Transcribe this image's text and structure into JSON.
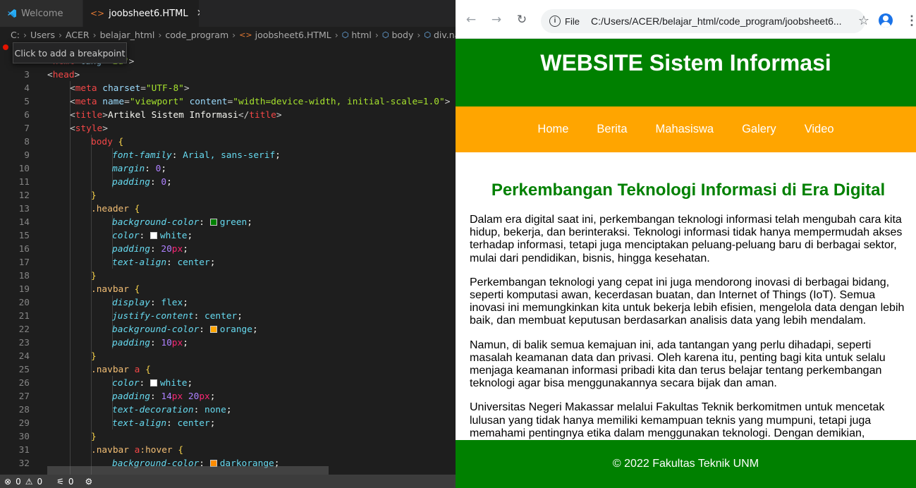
{
  "vscode": {
    "tabs": [
      {
        "label": "Welcome",
        "active": false
      },
      {
        "label": "joobsheet6.HTML",
        "active": true
      }
    ],
    "breadcrumb": [
      "C:",
      "Users",
      "ACER",
      "belajar_html",
      "code_program",
      "joobsheet6.HTML",
      "html",
      "body",
      "div.nav"
    ],
    "tooltip": "Click to add a breakpoint",
    "status": {
      "errors": "0",
      "warnings": "0",
      "ports": "0"
    },
    "lines": [
      {
        "n": "3",
        "text": "<head>"
      },
      {
        "n": "4",
        "text": "<meta charset=\"UTF-8\">"
      },
      {
        "n": "5",
        "text": "<meta name=\"viewport\" content=\"width=device-width, initial-scale=1.0\">"
      },
      {
        "n": "6",
        "text": "<title>Artikel Sistem Informasi</title>"
      },
      {
        "n": "7",
        "text": "<style>"
      },
      {
        "n": "8",
        "text": "body {"
      },
      {
        "n": "9",
        "text": "font-family: Arial, sans-serif;"
      },
      {
        "n": "10",
        "text": "margin: 0;"
      },
      {
        "n": "11",
        "text": "padding: 0;"
      },
      {
        "n": "12",
        "text": "}"
      },
      {
        "n": "13",
        "text": ".header {"
      },
      {
        "n": "14",
        "text": "background-color: green;"
      },
      {
        "n": "15",
        "text": "color: white;"
      },
      {
        "n": "16",
        "text": "padding: 20px;"
      },
      {
        "n": "17",
        "text": "text-align: center;"
      },
      {
        "n": "18",
        "text": "}"
      },
      {
        "n": "19",
        "text": ".navbar {"
      },
      {
        "n": "20",
        "text": "display: flex;"
      },
      {
        "n": "21",
        "text": "justify-content: center;"
      },
      {
        "n": "22",
        "text": "background-color: orange;"
      },
      {
        "n": "23",
        "text": "padding: 10px;"
      },
      {
        "n": "24",
        "text": "}"
      },
      {
        "n": "25",
        "text": ".navbar a {"
      },
      {
        "n": "26",
        "text": "color: white;"
      },
      {
        "n": "27",
        "text": "padding: 14px 20px;"
      },
      {
        "n": "28",
        "text": "text-decoration: none;"
      },
      {
        "n": "29",
        "text": "text-align: center;"
      },
      {
        "n": "30",
        "text": "}"
      },
      {
        "n": "31",
        "text": ".navbar a:hover {"
      },
      {
        "n": "32",
        "text": "background-color: darkorange;"
      }
    ]
  },
  "browser": {
    "omnibox_scheme": "File",
    "omnibox_url": "C:/Users/ACER/belajar_html/code_program/joobsheet6....",
    "page": {
      "header_title": "WEBSITE Sistem Informasi",
      "nav": [
        "Home",
        "Berita",
        "Mahasiswa",
        "Galery",
        "Video"
      ],
      "article_title": "Perkembangan Teknologi Informasi di Era Digital",
      "paragraphs": [
        "Dalam era digital saat ini, perkembangan teknologi informasi telah mengubah cara kita hidup, bekerja, dan berinteraksi. Teknologi informasi tidak hanya mempermudah akses terhadap informasi, tetapi juga menciptakan peluang-peluang baru di berbagai sektor, mulai dari pendidikan, bisnis, hingga kesehatan.",
        "Perkembangan teknologi yang cepat ini juga mendorong inovasi di berbagai bidang, seperti komputasi awan, kecerdasan buatan, dan Internet of Things (IoT). Semua inovasi ini memungkinkan kita untuk bekerja lebih efisien, mengelola data dengan lebih baik, dan membuat keputusan berdasarkan analisis data yang lebih mendalam.",
        "Namun, di balik semua kemajuan ini, ada tantangan yang perlu dihadapi, seperti masalah keamanan data dan privasi. Oleh karena itu, penting bagi kita untuk selalu menjaga keamanan informasi pribadi kita dan terus belajar tentang perkembangan teknologi agar bisa menggunakannya secara bijak dan aman.",
        "Universitas Negeri Makassar melalui Fakultas Teknik berkomitmen untuk mencetak lulusan yang tidak hanya memiliki kemampuan teknis yang mumpuni, tetapi juga memahami pentingnya etika dalam menggunakan teknologi. Dengan demikian,"
      ],
      "footer": "© 2022 Fakultas Teknik UNM"
    }
  },
  "colors": {
    "header_green": "#008000",
    "nav_orange": "#ffa500",
    "vscode_bg": "#1e1e1e"
  }
}
